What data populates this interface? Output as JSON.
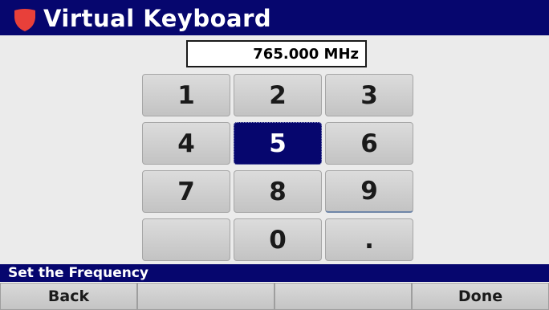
{
  "window": {
    "title": "Virtual Keyboard",
    "icon": "red-shield-icon",
    "accent_color": "#06066e"
  },
  "input": {
    "value": "765.000 MHz"
  },
  "keypad": {
    "selected_key": "5",
    "keys": [
      "1",
      "2",
      "3",
      "4",
      "5",
      "6",
      "7",
      "8",
      "9",
      "",
      "0",
      "."
    ]
  },
  "status": {
    "text": "Set the Frequency"
  },
  "softkeys": {
    "labels": [
      "Back",
      "",
      "",
      "Done"
    ]
  }
}
